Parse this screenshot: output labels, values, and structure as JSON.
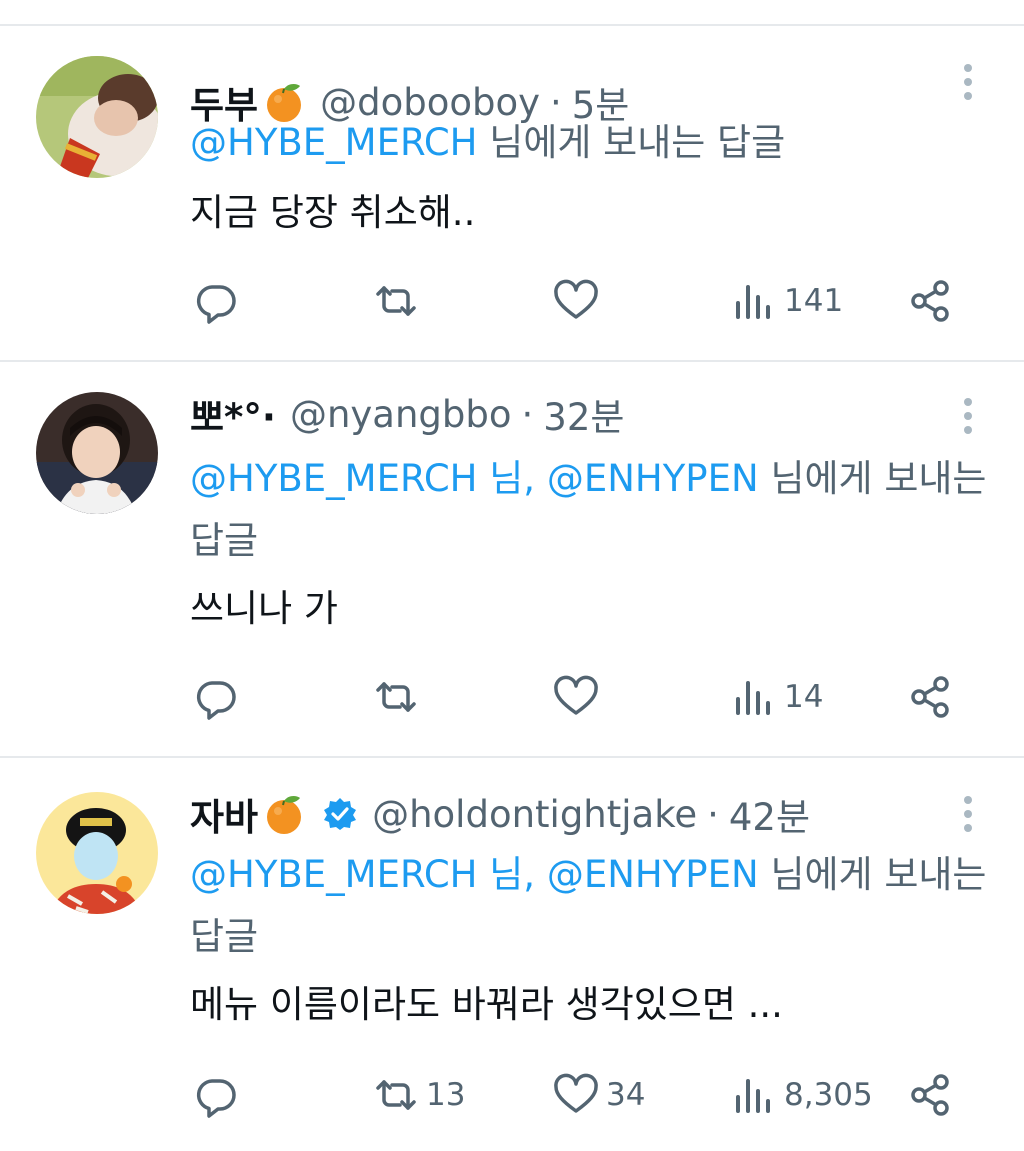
{
  "tweets": [
    {
      "display_name": "두부",
      "handle": "@dobooboy",
      "separator": "·",
      "time": "5분",
      "reply_mentions": "@HYBE_MERCH",
      "reply_suffix": " 님에게 보내는 답글",
      "text": "지금 당장 취소해..",
      "retweets": "",
      "likes": "",
      "views": "141",
      "has_emoji": true,
      "verified": false
    },
    {
      "display_name": "뽀*°·",
      "handle": "@nyangbbo",
      "separator": "·",
      "time": "32분",
      "reply_mentions": "@HYBE_MERCH 님, @ENHYPEN",
      "reply_suffix": " 님에게 보내는 답글",
      "text": "쓰니나 가",
      "retweets": "",
      "likes": "",
      "views": "14",
      "has_emoji": false,
      "verified": false
    },
    {
      "display_name": "자바",
      "handle": "@holdontightjake",
      "separator": "·",
      "time": "42분",
      "reply_mentions": "@HYBE_MERCH 님, @ENHYPEN",
      "reply_suffix": " 님에게 보내는 답글",
      "text": "메뉴 이름이라도 바꿔라 생각있으면 ...",
      "retweets": "13",
      "likes": "34",
      "views": "8,305",
      "has_emoji": true,
      "verified": true
    }
  ],
  "icons": {
    "reply": "reply-icon",
    "retweet": "retweet-icon",
    "like": "heart-icon",
    "views": "views-icon",
    "share": "share-icon",
    "more": "more-icon",
    "emoji": "tangerine-emoji",
    "verified": "verified-badge-icon"
  },
  "colors": {
    "link": "#1d9bf0",
    "secondary": "#536471",
    "primary_text": "#0f1419",
    "divider": "#e6e9ec"
  }
}
